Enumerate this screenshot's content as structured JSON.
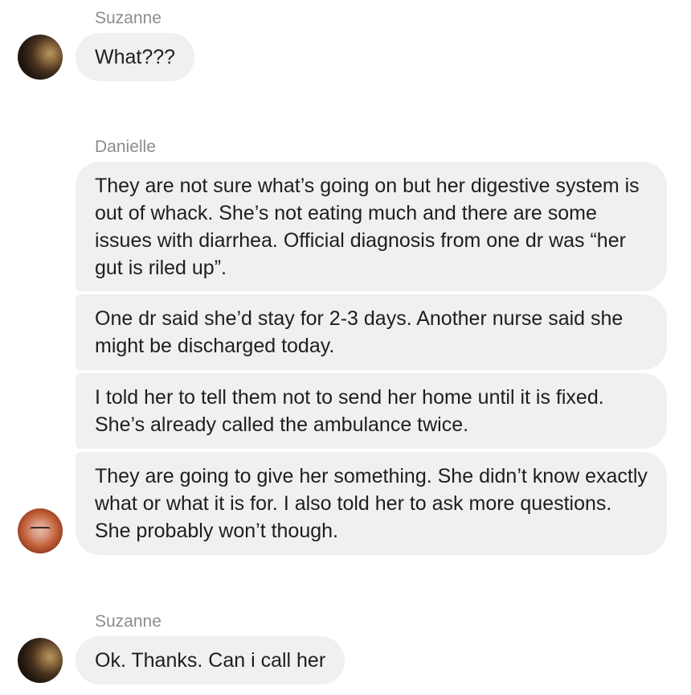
{
  "thread": [
    {
      "sender": "Suzanne",
      "avatar_icon": "suzanne-avatar",
      "messages": [
        "What???"
      ]
    },
    {
      "sender": "Danielle",
      "avatar_icon": "danielle-avatar",
      "messages": [
        "They are not sure what’s going on but her digestive system is out of whack. She’s not eating much and there are some issues with diarrhea. Official diagnosis from one dr was “her gut is riled up”.",
        "One dr said she’d stay for 2-3 days. Another nurse said she might be discharged today.",
        "I told her to tell them not to send her home until it is fixed. She’s already called the ambulance twice.",
        "They are going to give her something. She didn’t know exactly what or what it is for. I also told her to ask more questions. She probably won’t though."
      ]
    },
    {
      "sender": "Suzanne",
      "avatar_icon": "suzanne-avatar",
      "messages": [
        "Ok. Thanks. Can i call her"
      ]
    }
  ],
  "colors": {
    "bubble_background": "#f0f0f0",
    "sender_name": "#8a8d91",
    "message_text": "#1c1e21"
  }
}
